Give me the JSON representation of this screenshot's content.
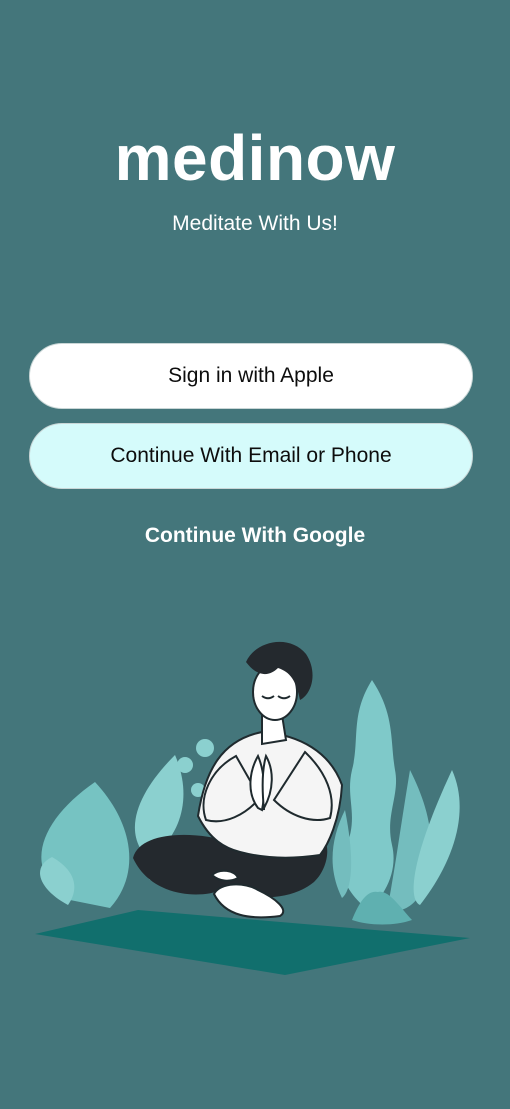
{
  "app": {
    "title": "medinow",
    "subtitle": "Meditate With Us!"
  },
  "auth": {
    "apple_label": "Sign in with Apple",
    "email_label": "Continue With Email or Phone",
    "google_label": "Continue With Google"
  },
  "colors": {
    "background": "#44767b",
    "apple_button": "#ffffff",
    "email_button": "#d5fbfb",
    "leaf": "#7fc9c9",
    "mat": "#116f6d"
  },
  "illustration": {
    "icon": "meditating-person-illustration"
  }
}
